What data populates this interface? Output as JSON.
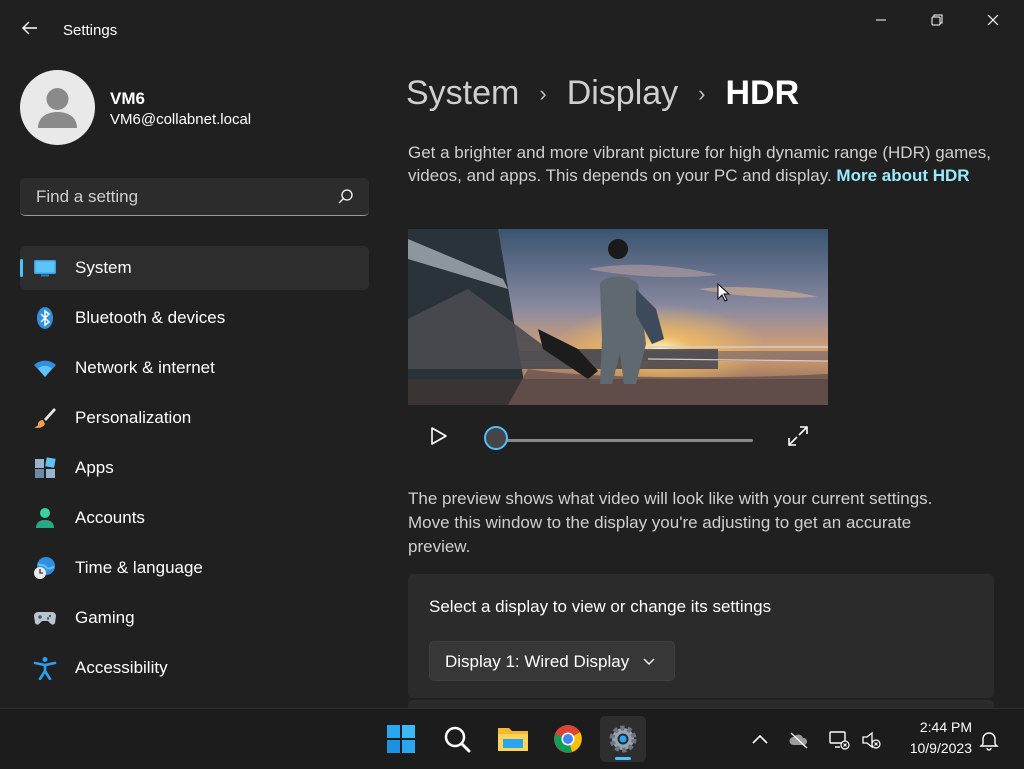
{
  "window": {
    "title": "Settings"
  },
  "user": {
    "name": "VM6",
    "email": "VM6@collabnet.local"
  },
  "search": {
    "placeholder": "Find a setting"
  },
  "nav": {
    "items": [
      {
        "label": "System",
        "icon": "system-icon",
        "active": true
      },
      {
        "label": "Bluetooth & devices",
        "icon": "bluetooth-icon"
      },
      {
        "label": "Network & internet",
        "icon": "wifi-icon"
      },
      {
        "label": "Personalization",
        "icon": "brush-icon"
      },
      {
        "label": "Apps",
        "icon": "apps-icon"
      },
      {
        "label": "Accounts",
        "icon": "accounts-icon"
      },
      {
        "label": "Time & language",
        "icon": "globe-clock-icon"
      },
      {
        "label": "Gaming",
        "icon": "gamepad-icon"
      },
      {
        "label": "Accessibility",
        "icon": "accessibility-icon"
      }
    ]
  },
  "breadcrumb": {
    "level1": "System",
    "level2": "Display",
    "current": "HDR",
    "separator": "›"
  },
  "description": {
    "text": "Get a brighter and more vibrant picture for high dynamic range (HDR) games, videos, and apps. This depends on your PC and display. ",
    "link": "More about HDR"
  },
  "video": {
    "progress": 0
  },
  "preview_note": "The preview shows what video will look like with your current settings. Move this window to the display you're adjusting to get an accurate preview.",
  "display_card": {
    "title": "Select a display to view or change its settings",
    "selected": "Display 1: Wired Display"
  },
  "taskbar": {
    "apps": [
      "windows-start-icon",
      "search-icon",
      "file-explorer-icon",
      "chrome-icon",
      "settings-icon"
    ],
    "active_app": "settings-icon"
  },
  "clock": {
    "time": "2:44 PM",
    "date": "10/9/2023"
  },
  "colors": {
    "accent": "#4cc2ff",
    "link": "#99ebff",
    "background": "#202020",
    "card": "#2b2b2b"
  }
}
